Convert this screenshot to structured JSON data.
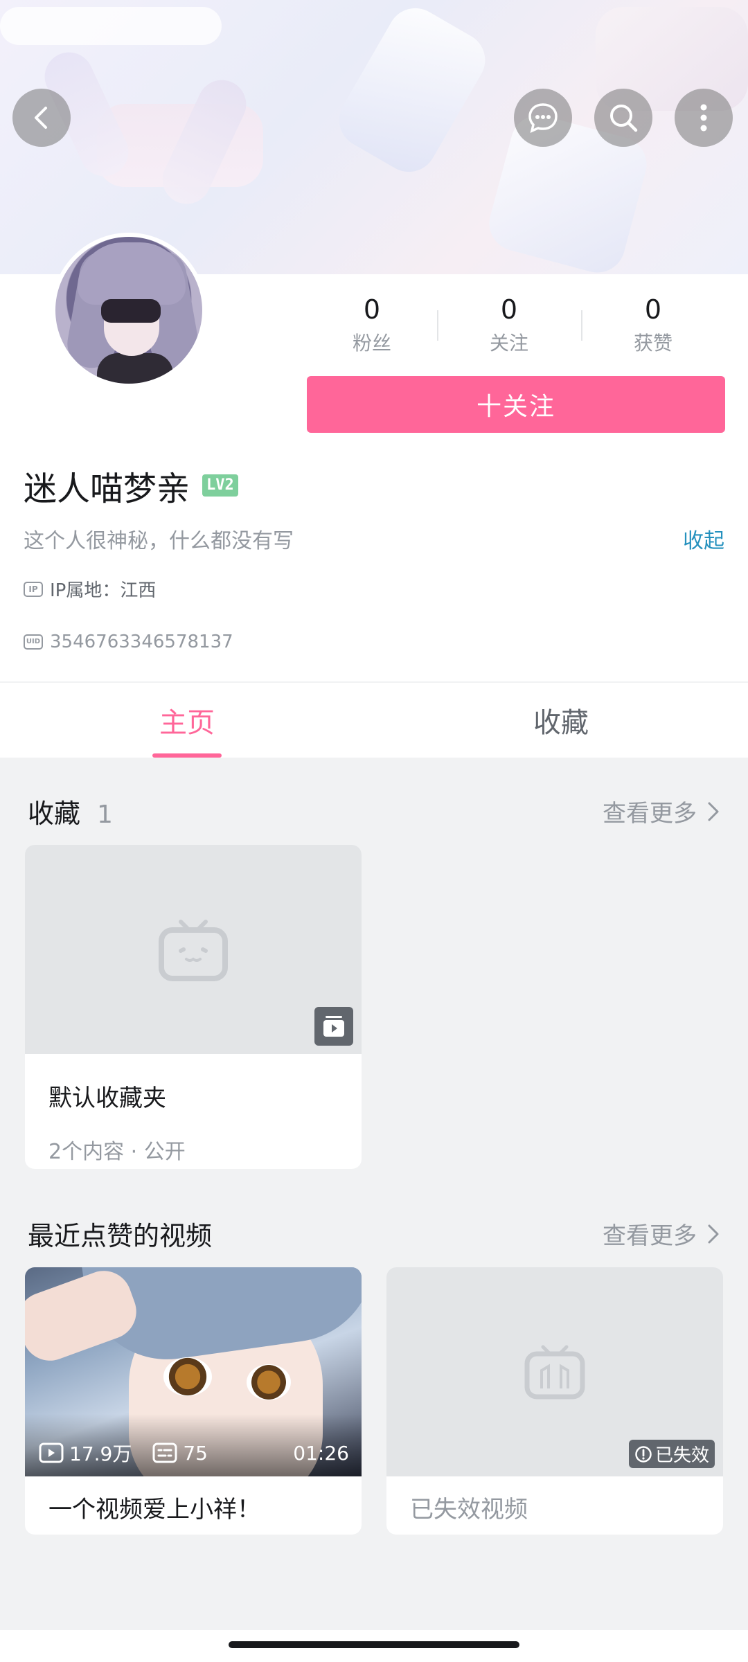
{
  "profile": {
    "username": "迷人喵梦亲",
    "level_badge": "LV2",
    "bio": "这个人很神秘，什么都没有写",
    "collapse_label": "收起",
    "ip_label": "IP属地：江西",
    "ip_icon": "IP",
    "uid": "3546763346578137",
    "uid_icon": "UID",
    "stats": [
      {
        "value": "0",
        "label": "粉丝"
      },
      {
        "value": "0",
        "label": "关注"
      },
      {
        "value": "0",
        "label": "获赞"
      }
    ],
    "follow_label": "十关注"
  },
  "tabs": [
    {
      "label": "主页",
      "active": true
    },
    {
      "label": "收藏",
      "active": false
    }
  ],
  "favorites_section": {
    "title": "收藏",
    "count": "1",
    "see_more": "查看更多",
    "folder": {
      "title": "默认收藏夹",
      "subtitle": "2个内容 · 公开"
    }
  },
  "liked_section": {
    "title": "最近点赞的视频",
    "see_more": "查看更多",
    "videos": [
      {
        "title": "一个视频爱上小祥！",
        "views": "17.9万",
        "danmaku": "75",
        "duration": "01:26"
      },
      {
        "title": "已失效视频",
        "badge": "已失效"
      }
    ]
  },
  "icons": {
    "back": "chevron-left-icon",
    "message": "chat-bubble-icon",
    "search": "search-icon",
    "more": "more-vertical-icon",
    "see_more": "chevron-right-icon",
    "placeholder": "bilibili-tv-icon",
    "folder_badge": "playlist-icon",
    "play": "play-icon",
    "danmaku": "danmaku-icon",
    "warning": "warning-icon"
  },
  "colors": {
    "accent": "#ff6699",
    "link": "#2591be",
    "level": "#7ecf9c"
  }
}
